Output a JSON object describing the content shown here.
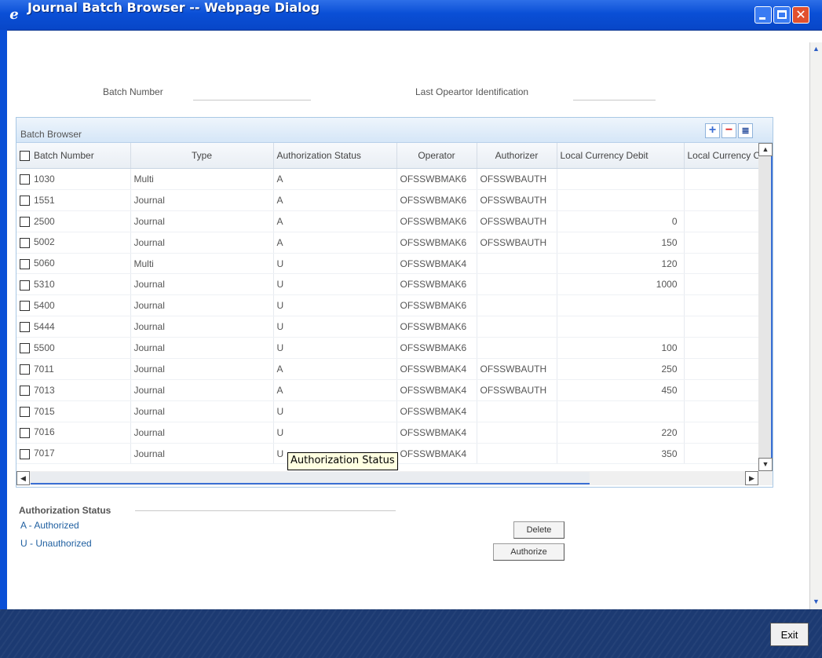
{
  "window": {
    "title": "Journal Batch Browser -- Webpage Dialog",
    "icon": "ie-icon",
    "min_label": "",
    "max_label": "",
    "close_label": "✕"
  },
  "search": {
    "batch_number_label": "Batch Number",
    "batch_number_value": "",
    "last_operator_label": "Last Opeartor Identification",
    "last_operator_value": ""
  },
  "grid": {
    "title": "Batch Browser",
    "add_label": "+",
    "delete_label": "−",
    "view_label": "≣",
    "columns": [
      "Batch Number",
      "Type",
      "Authorization Status",
      "Operator",
      "Authorizer",
      "Local Currency Debit",
      "Local Currency Credit"
    ],
    "rows": [
      [
        "1030",
        "Multi",
        "A",
        "OFSSWBMAK6",
        "OFSSWBAUTH",
        "",
        ""
      ],
      [
        "1551",
        "Journal",
        "A",
        "OFSSWBMAK6",
        "OFSSWBAUTH",
        "",
        ""
      ],
      [
        "2500",
        "Journal",
        "A",
        "OFSSWBMAK6",
        "OFSSWBAUTH",
        "0",
        ""
      ],
      [
        "5002",
        "Journal",
        "A",
        "OFSSWBMAK6",
        "OFSSWBAUTH",
        "150",
        ""
      ],
      [
        "5060",
        "Multi",
        "U",
        "OFSSWBMAK4",
        "",
        "120",
        ""
      ],
      [
        "5310",
        "Journal",
        "U",
        "OFSSWBMAK6",
        "",
        "1000",
        ""
      ],
      [
        "5400",
        "Journal",
        "U",
        "OFSSWBMAK6",
        "",
        "",
        ""
      ],
      [
        "5444",
        "Journal",
        "U",
        "OFSSWBMAK6",
        "",
        "",
        ""
      ],
      [
        "5500",
        "Journal",
        "U",
        "OFSSWBMAK6",
        "",
        "100",
        ""
      ],
      [
        "7011",
        "Journal",
        "A",
        "OFSSWBMAK4",
        "OFSSWBAUTH",
        "250",
        ""
      ],
      [
        "7013",
        "Journal",
        "A",
        "OFSSWBMAK4",
        "OFSSWBAUTH",
        "450",
        ""
      ],
      [
        "7015",
        "Journal",
        "U",
        "OFSSWBMAK4",
        "",
        "",
        ""
      ],
      [
        "7016",
        "Journal",
        "U",
        "OFSSWBMAK4",
        "",
        "220",
        ""
      ],
      [
        "7017",
        "Journal",
        "U",
        "OFSSWBMAK4",
        "",
        "350",
        ""
      ]
    ],
    "tooltip": "Authorization Status"
  },
  "legend": {
    "title": "Authorization Status",
    "items": [
      "A - Authorized",
      "U - Unauthorized"
    ]
  },
  "actions": {
    "delete_label": "Delete",
    "authorize_label": "Authorize",
    "exit_label": "Exit"
  },
  "colors": {
    "titlebar": "#0a4fd6",
    "footer": "#1c3a72",
    "grid_border": "#a9c8e5",
    "legend_text": "#1f5fa0"
  }
}
